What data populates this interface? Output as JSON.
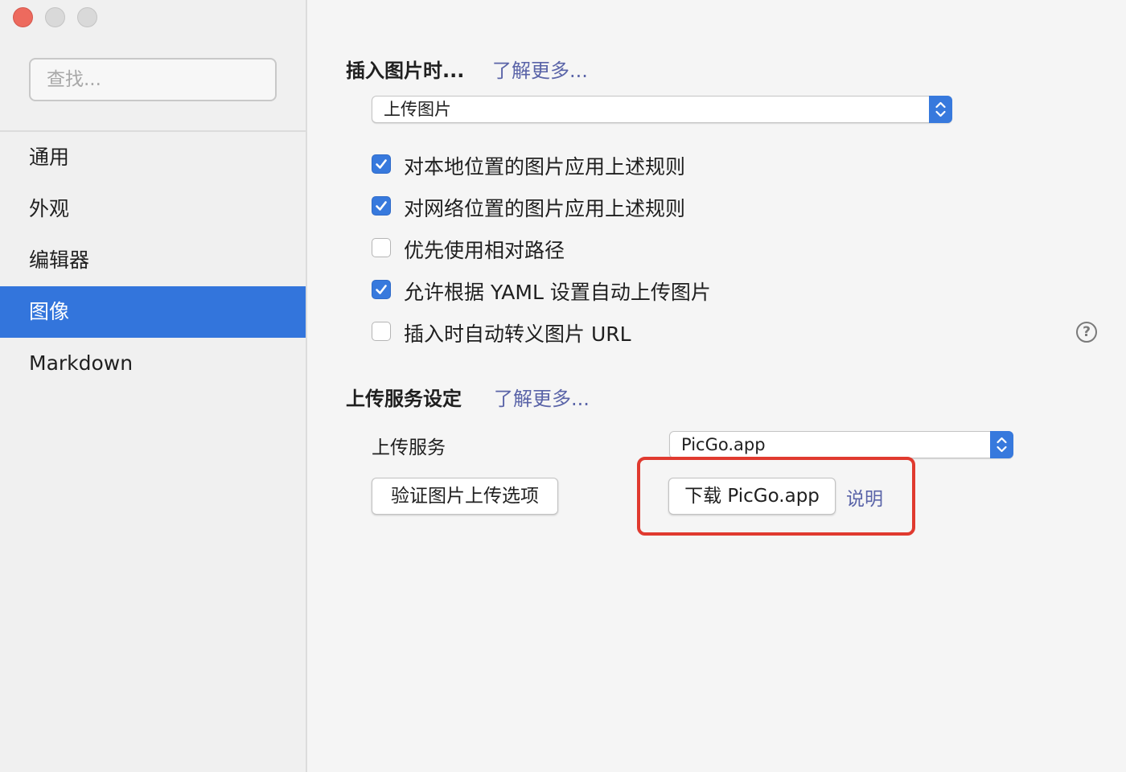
{
  "window": {
    "controls": [
      "close",
      "minimize",
      "maximize"
    ]
  },
  "sidebar": {
    "search_placeholder": "查找...",
    "items": [
      {
        "label": "通用",
        "active": false
      },
      {
        "label": "外观",
        "active": false
      },
      {
        "label": "编辑器",
        "active": false
      },
      {
        "label": "图像",
        "active": true
      },
      {
        "label": "Markdown",
        "active": false
      }
    ]
  },
  "insert_image": {
    "title": "插入图片时...",
    "learn_more": "了解更多...",
    "action_select": "上传图片",
    "options": [
      {
        "label": "对本地位置的图片应用上述规则",
        "checked": true
      },
      {
        "label": "对网络位置的图片应用上述规则",
        "checked": true
      },
      {
        "label": "优先使用相对路径",
        "checked": false
      },
      {
        "label": "允许根据 YAML 设置自动上传图片",
        "checked": true
      },
      {
        "label": "插入时自动转义图片 URL",
        "checked": false
      }
    ],
    "help_icon": "question-circle-icon",
    "help_glyph": "?"
  },
  "upload_service": {
    "title": "上传服务设定",
    "learn_more": "了解更多...",
    "service_label": "上传服务",
    "service_select": "PicGo.app",
    "verify_button": "验证图片上传选项",
    "download_button": "下载 PicGo.app",
    "docs_link": "说明"
  },
  "colors": {
    "accent": "#3779dd",
    "sidebar_active": "#3375dc",
    "link": "#5a64a8",
    "highlight": "#e03a2f"
  }
}
